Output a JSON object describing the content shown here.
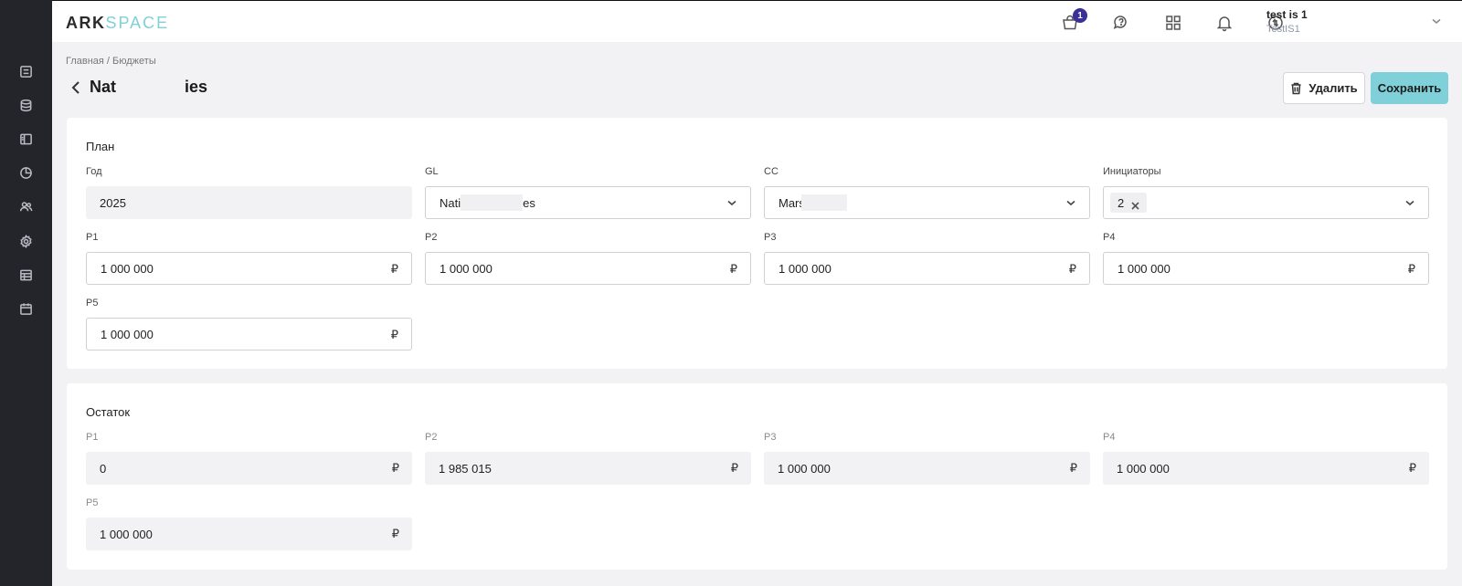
{
  "app": {
    "logo_ark": "ARK",
    "logo_space": "SPACE"
  },
  "header": {
    "cart_badge": "1",
    "user_name": "test is 1",
    "user_org": "TestIS1"
  },
  "breadcrumb": "Главная / Бюджеты",
  "page": {
    "title_start": "Nat",
    "title_end": "ies",
    "delete_label": "Удалить",
    "save_label": "Сохранить"
  },
  "plan": {
    "title": "План",
    "year_label": "Год",
    "year_value": "2025",
    "gl_label": "GL",
    "gl_value_start": "Nati",
    "gl_value_end": "es",
    "cc_label": "CC",
    "cc_value_start": "Mars",
    "initiators_label": "Инициаторы",
    "initiators_chip": "2",
    "periods": [
      {
        "label": "P1",
        "value": "1 000 000"
      },
      {
        "label": "P2",
        "value": "1 000 000"
      },
      {
        "label": "P3",
        "value": "1 000 000"
      },
      {
        "label": "P4",
        "value": "1 000 000"
      },
      {
        "label": "P5",
        "value": "1 000 000"
      }
    ]
  },
  "remainder": {
    "title": "Остаток",
    "periods": [
      {
        "label": "P1",
        "value": "0"
      },
      {
        "label": "P2",
        "value": "1 985 015"
      },
      {
        "label": "P3",
        "value": "1 000 000"
      },
      {
        "label": "P4",
        "value": "1 000 000"
      },
      {
        "label": "P5",
        "value": "1 000 000"
      }
    ]
  },
  "currency": "₽",
  "icons": {
    "sidebar": [
      "list-icon",
      "database-icon",
      "layout-icon",
      "pie-chart-icon",
      "users-icon",
      "settings-icon",
      "table-icon",
      "calendar-icon"
    ],
    "header": [
      "cart-icon",
      "chat-icon",
      "apps-grid-icon",
      "bell-icon",
      "sync-icon"
    ]
  }
}
